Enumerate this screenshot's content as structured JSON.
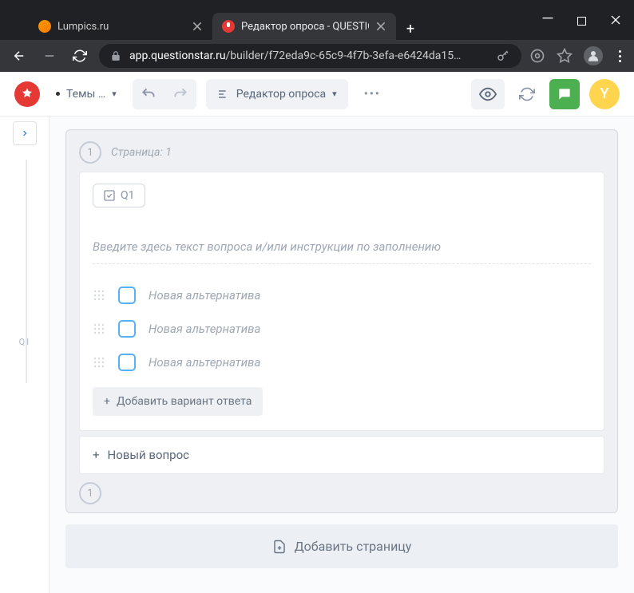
{
  "browser": {
    "tabs": [
      {
        "title": "Lumpics.ru",
        "favicon": "lumpics"
      },
      {
        "title": "Редактор опроса - QUESTIONST",
        "favicon": "qs"
      }
    ],
    "url_prefix": "app.questionstar.ru",
    "url_suffix": "/builder/f72eda9c-65c9-4f7b-3efa-e6424da15…"
  },
  "toolbar": {
    "themes_label": "Темы …",
    "editor_label": "Редактор опроса",
    "avatar_letter": "Y"
  },
  "sidebar": {
    "mini_label": "Q1"
  },
  "page": {
    "number": "1",
    "title": "Страница: 1",
    "footer_number": "1"
  },
  "question": {
    "id_label": "Q1",
    "prompt_placeholder": "Введите здесь текст вопроса и/или инструкции по заполнению",
    "options": [
      {
        "label": "Новая альтернатива"
      },
      {
        "label": "Новая альтернатива"
      },
      {
        "label": "Новая альтернатива"
      }
    ],
    "add_option_label": "Добавить вариант ответа"
  },
  "new_question_label": "Новый вопрос",
  "add_page_label": "Добавить страницу"
}
